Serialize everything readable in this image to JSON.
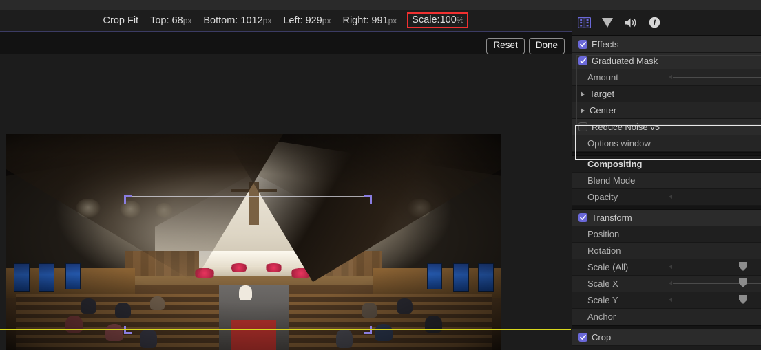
{
  "viewer": {
    "crop_bar": {
      "mode_label": "Crop Fit",
      "top_label": "Top:",
      "top_value": "68",
      "bottom_label": "Bottom:",
      "bottom_value": "1012",
      "left_label": "Left:",
      "left_value": "929",
      "right_label": "Right:",
      "right_value": "991",
      "unit": "px",
      "scale_label": "Scale:",
      "scale_value": "100",
      "scale_unit": "%",
      "highlight_color": "#f03030"
    },
    "buttons": {
      "reset_label": "Reset",
      "done_label": "Done"
    },
    "overlay": {
      "handle_color": "#8a7de0",
      "guide_color": "#d8d81e"
    }
  },
  "inspector": {
    "toolbar": {
      "icons": [
        {
          "name": "film-strip-icon",
          "active": true
        },
        {
          "name": "filter-triangle-icon",
          "active": false
        },
        {
          "name": "audio-speaker-icon",
          "active": false
        },
        {
          "name": "info-icon",
          "active": false
        }
      ]
    },
    "accent_color": "#6a68d8",
    "rows": [
      {
        "label": "Effects",
        "kind": "checkbox",
        "checked": true,
        "slider": false
      },
      {
        "label": "Graduated Mask",
        "kind": "checkbox",
        "checked": true,
        "slider": false
      },
      {
        "label": "Amount",
        "kind": "sub",
        "slider": true,
        "knob": false
      },
      {
        "label": "Target",
        "kind": "disclosure",
        "slider": false
      },
      {
        "label": "Center",
        "kind": "disclosure",
        "slider": false
      },
      {
        "label": "Reduce Noise v5",
        "kind": "checkbox",
        "checked": false,
        "slider": false
      },
      {
        "label": "Options window",
        "kind": "sub",
        "slider": false
      },
      {
        "label": "Compositing",
        "kind": "header",
        "slider": false
      },
      {
        "label": "Blend Mode",
        "kind": "sub",
        "slider": false
      },
      {
        "label": "Opacity",
        "kind": "sub",
        "slider": true,
        "knob": false
      },
      {
        "label": "Transform",
        "kind": "checkbox",
        "checked": true,
        "slider": false
      },
      {
        "label": "Position",
        "kind": "sub",
        "slider": false
      },
      {
        "label": "Rotation",
        "kind": "sub",
        "slider": false
      },
      {
        "label": "Scale (All)",
        "kind": "sub",
        "slider": true,
        "knob": true
      },
      {
        "label": "Scale X",
        "kind": "sub",
        "slider": true,
        "knob": true
      },
      {
        "label": "Scale Y",
        "kind": "sub",
        "slider": true,
        "knob": true
      },
      {
        "label": "Anchor",
        "kind": "sub",
        "slider": false
      },
      {
        "label": "Crop",
        "kind": "checkbox",
        "checked": true,
        "slider": false
      }
    ]
  }
}
